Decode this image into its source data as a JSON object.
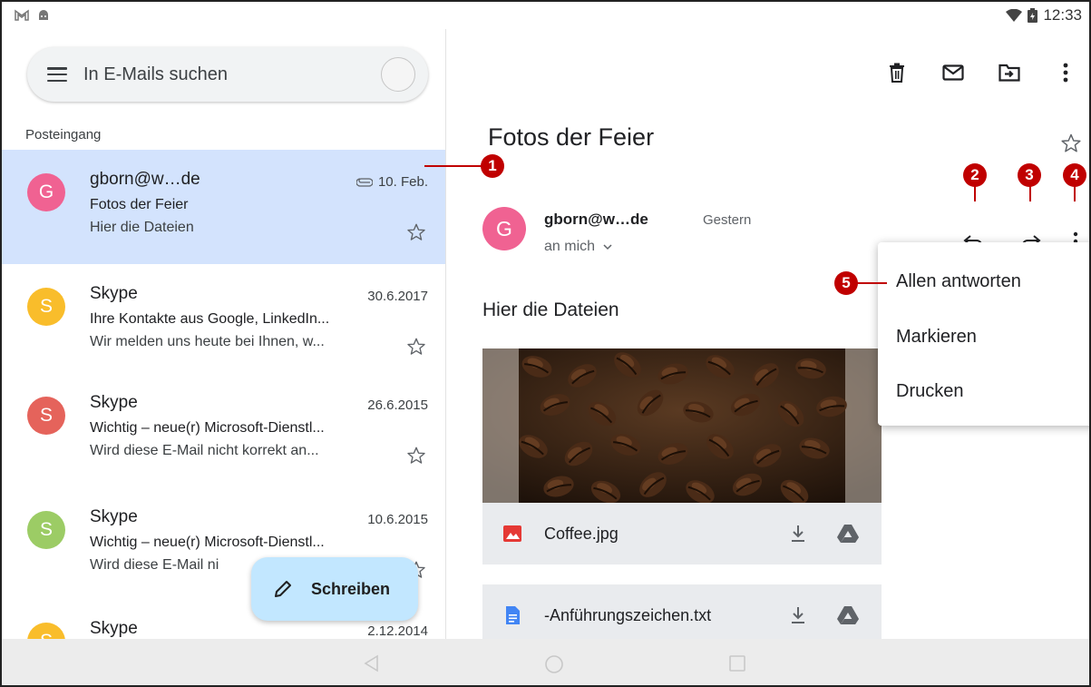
{
  "status_bar": {
    "time": "12:33",
    "left_icons": [
      "gmail-notification-icon",
      "android-notification-icon"
    ],
    "right_icons": [
      "wifi-icon",
      "battery-icon"
    ]
  },
  "search": {
    "placeholder": "In E-Mails suchen"
  },
  "folder_label": "Posteingang",
  "mails": [
    {
      "avatar": "G",
      "avatar_color": "#f06292",
      "from": "gborn@w…de",
      "subject": "Fotos der Feier",
      "preview": "Hier die Dateien",
      "date": "10. Feb.",
      "attachment": true,
      "selected": true
    },
    {
      "avatar": "S",
      "avatar_color": "#f9bd2b",
      "from": "Skype",
      "subject": "Ihre Kontakte aus Google, LinkedIn...",
      "preview": "Wir melden uns heute bei Ihnen, w...",
      "date": "30.6.2017",
      "attachment": false,
      "selected": false
    },
    {
      "avatar": "S",
      "avatar_color": "#e5635b",
      "from": "Skype",
      "subject": "Wichtig – neue(r) Microsoft-Dienstl...",
      "preview": "Wird diese E-Mail nicht korrekt an...",
      "date": "26.6.2015",
      "attachment": false,
      "selected": false
    },
    {
      "avatar": "S",
      "avatar_color": "#9ccc65",
      "from": "Skype",
      "subject": "Wichtig – neue(r) Microsoft-Dienstl...",
      "preview": "Wird diese E-Mail ni",
      "date": "10.6.2015",
      "attachment": false,
      "selected": false
    },
    {
      "avatar": "S",
      "avatar_color": "#f9bd2b",
      "from": "Skype",
      "subject": "",
      "preview": "",
      "date": "2.12.2014",
      "attachment": false,
      "selected": false
    }
  ],
  "compose_label": "Schreiben",
  "toolbar_icons": [
    "delete-icon",
    "mark-unread-icon",
    "move-to-icon",
    "more-vert-icon"
  ],
  "message": {
    "subject": "Fotos der Feier",
    "sender_avatar": "G",
    "sender": "gborn@w…de",
    "when": "Gestern",
    "recipient": "an mich",
    "body": "Hier die Dateien"
  },
  "attachments": [
    {
      "name": "Coffee.jpg",
      "type": "image",
      "icon_color": "#e53935"
    },
    {
      "name": "-Anführungszeichen.txt",
      "type": "doc",
      "icon_color": "#4285f4"
    }
  ],
  "overflow_menu": {
    "items": [
      "Allen antworten",
      "Markieren",
      "Drucken"
    ]
  },
  "callouts": [
    "1",
    "2",
    "3",
    "4",
    "5"
  ]
}
